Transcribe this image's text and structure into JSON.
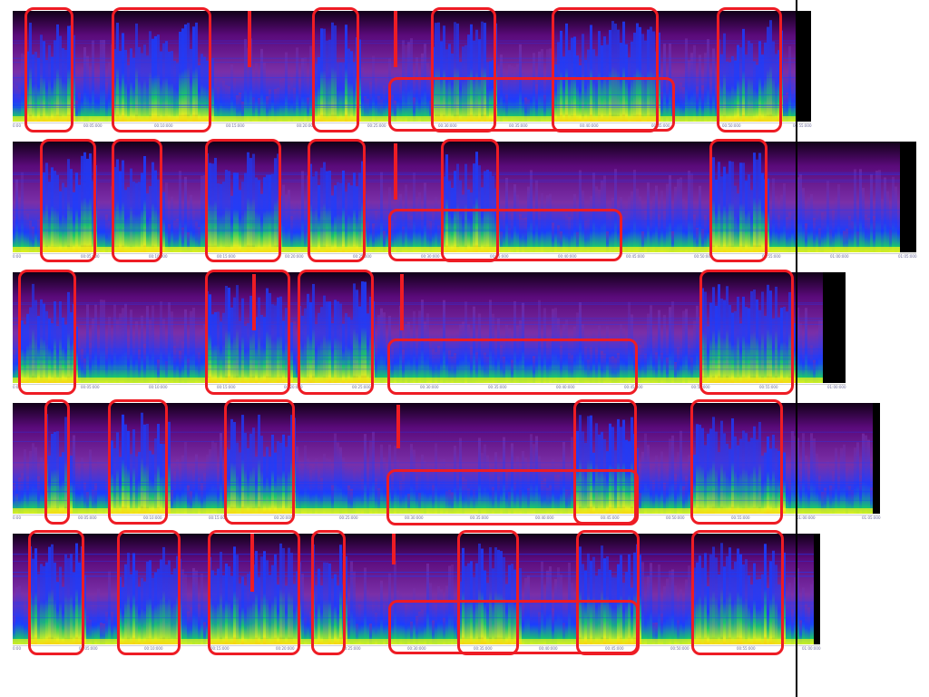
{
  "colors": {
    "highlight": "#ee1c24",
    "divider": "#000000",
    "palette": [
      "#120018",
      "#5a0a7a",
      "#7a2fa8",
      "#1a3dff",
      "#19d65a",
      "#f2f21a",
      "#ff8a00"
    ]
  },
  "strips": [
    {
      "id": "strip-1",
      "tick_labels": [
        "0:00",
        "00:05:000",
        "00:10:000",
        "00:15:000",
        "00:20:000",
        "00:25:000",
        "00:30:000",
        "00:35:000",
        "00:40:000",
        "00:45:000",
        "00:50:000",
        "00:55:000"
      ]
    },
    {
      "id": "strip-2",
      "tick_labels": [
        "0:00",
        "00:05:000",
        "00:10:000",
        "00:15:000",
        "00:20:000",
        "00:25:000",
        "00:30:000",
        "00:35:000",
        "00:40:000",
        "00:45:000",
        "00:50:000",
        "00:55:000",
        "01:00:000",
        "01:05:000"
      ]
    },
    {
      "id": "strip-3",
      "tick_labels": [
        "0:00",
        "00:05:000",
        "00:10:000",
        "00:15:000",
        "00:20:000",
        "00:25:000",
        "00:30:000",
        "00:35:000",
        "00:40:000",
        "00:45:000",
        "00:50:000",
        "00:55:000",
        "01:00:000"
      ]
    },
    {
      "id": "strip-4",
      "tick_labels": [
        "0:00",
        "00:05:000",
        "00:10:000",
        "00:15:000",
        "00:20:000",
        "00:25:000",
        "00:30:000",
        "00:35:000",
        "00:40:000",
        "00:45:000",
        "00:50:000",
        "00:55:000",
        "01:00:000",
        "01:05:000"
      ]
    },
    {
      "id": "strip-5",
      "tick_labels": [
        "0:00",
        "00:05:000",
        "00:10:000",
        "00:15:000",
        "00:20:000",
        "00:25:000",
        "00:30:000",
        "00:35:000",
        "00:40:000",
        "00:45:000",
        "00:50:000",
        "00:55:000",
        "01:00:000"
      ]
    }
  ]
}
